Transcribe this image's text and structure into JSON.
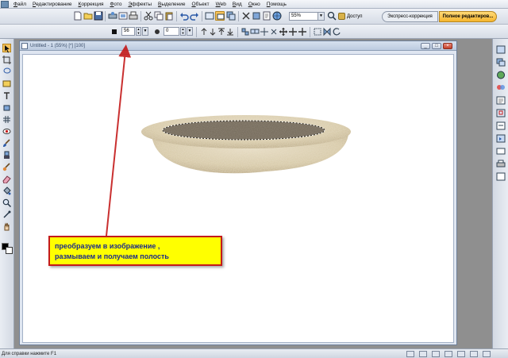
{
  "menubar": {
    "items": [
      {
        "label": "Файл",
        "accel": "Ф",
        "rest": "айл"
      },
      {
        "label": "Редактирование",
        "accel": "Р",
        "rest": "едактирование"
      },
      {
        "label": "Коррекция",
        "accel": "К",
        "rest": "оррекция"
      },
      {
        "label": "Фото",
        "accel": "Ф",
        "rest": "ото"
      },
      {
        "label": "Эффекты",
        "accel": "Э",
        "rest": "ффекты"
      },
      {
        "label": "Выделение",
        "accel": "В",
        "rest": "ыделение"
      },
      {
        "label": "Объект",
        "accel": "О",
        "rest": "бъект"
      },
      {
        "label": "Web",
        "accel": "W",
        "rest": "eb"
      },
      {
        "label": "Вид",
        "accel": "В",
        "rest": "ид"
      },
      {
        "label": "Окно",
        "accel": "О",
        "rest": "кно"
      },
      {
        "label": "Помощь",
        "accel": "П",
        "rest": "омощь"
      }
    ]
  },
  "toolbar": {
    "zoom_value": "55%",
    "access_label": "Доступ",
    "express_tab": "Экспресс-коррекция",
    "full_editor_tab": "Полное редактиров..."
  },
  "options": {
    "size_value": "56",
    "opacity_value": "0"
  },
  "document": {
    "title": "Untitled - 1 (55%) [*] [100]"
  },
  "callout": {
    "line1": "преобразуем в изображение ,",
    "line2": "размываем и получаем полость"
  },
  "status": {
    "text": "Для справки нажмите F1"
  },
  "colors": {
    "accent_red": "#c41a1a",
    "callout_fill": "#ffff00",
    "callout_text": "#1b2a8a",
    "active_tab": "#f6b52e"
  },
  "icons": [
    "new-icon",
    "open-icon",
    "save-icon",
    "print-icon",
    "cut-icon",
    "copy-icon",
    "paste-icon",
    "undo-icon",
    "redo-icon",
    "zoom-icon",
    "crop-icon",
    "move-icon",
    "brush-icon",
    "text-icon",
    "eraser-icon",
    "eyedropper-icon",
    "layers-icon",
    "help-icon"
  ]
}
